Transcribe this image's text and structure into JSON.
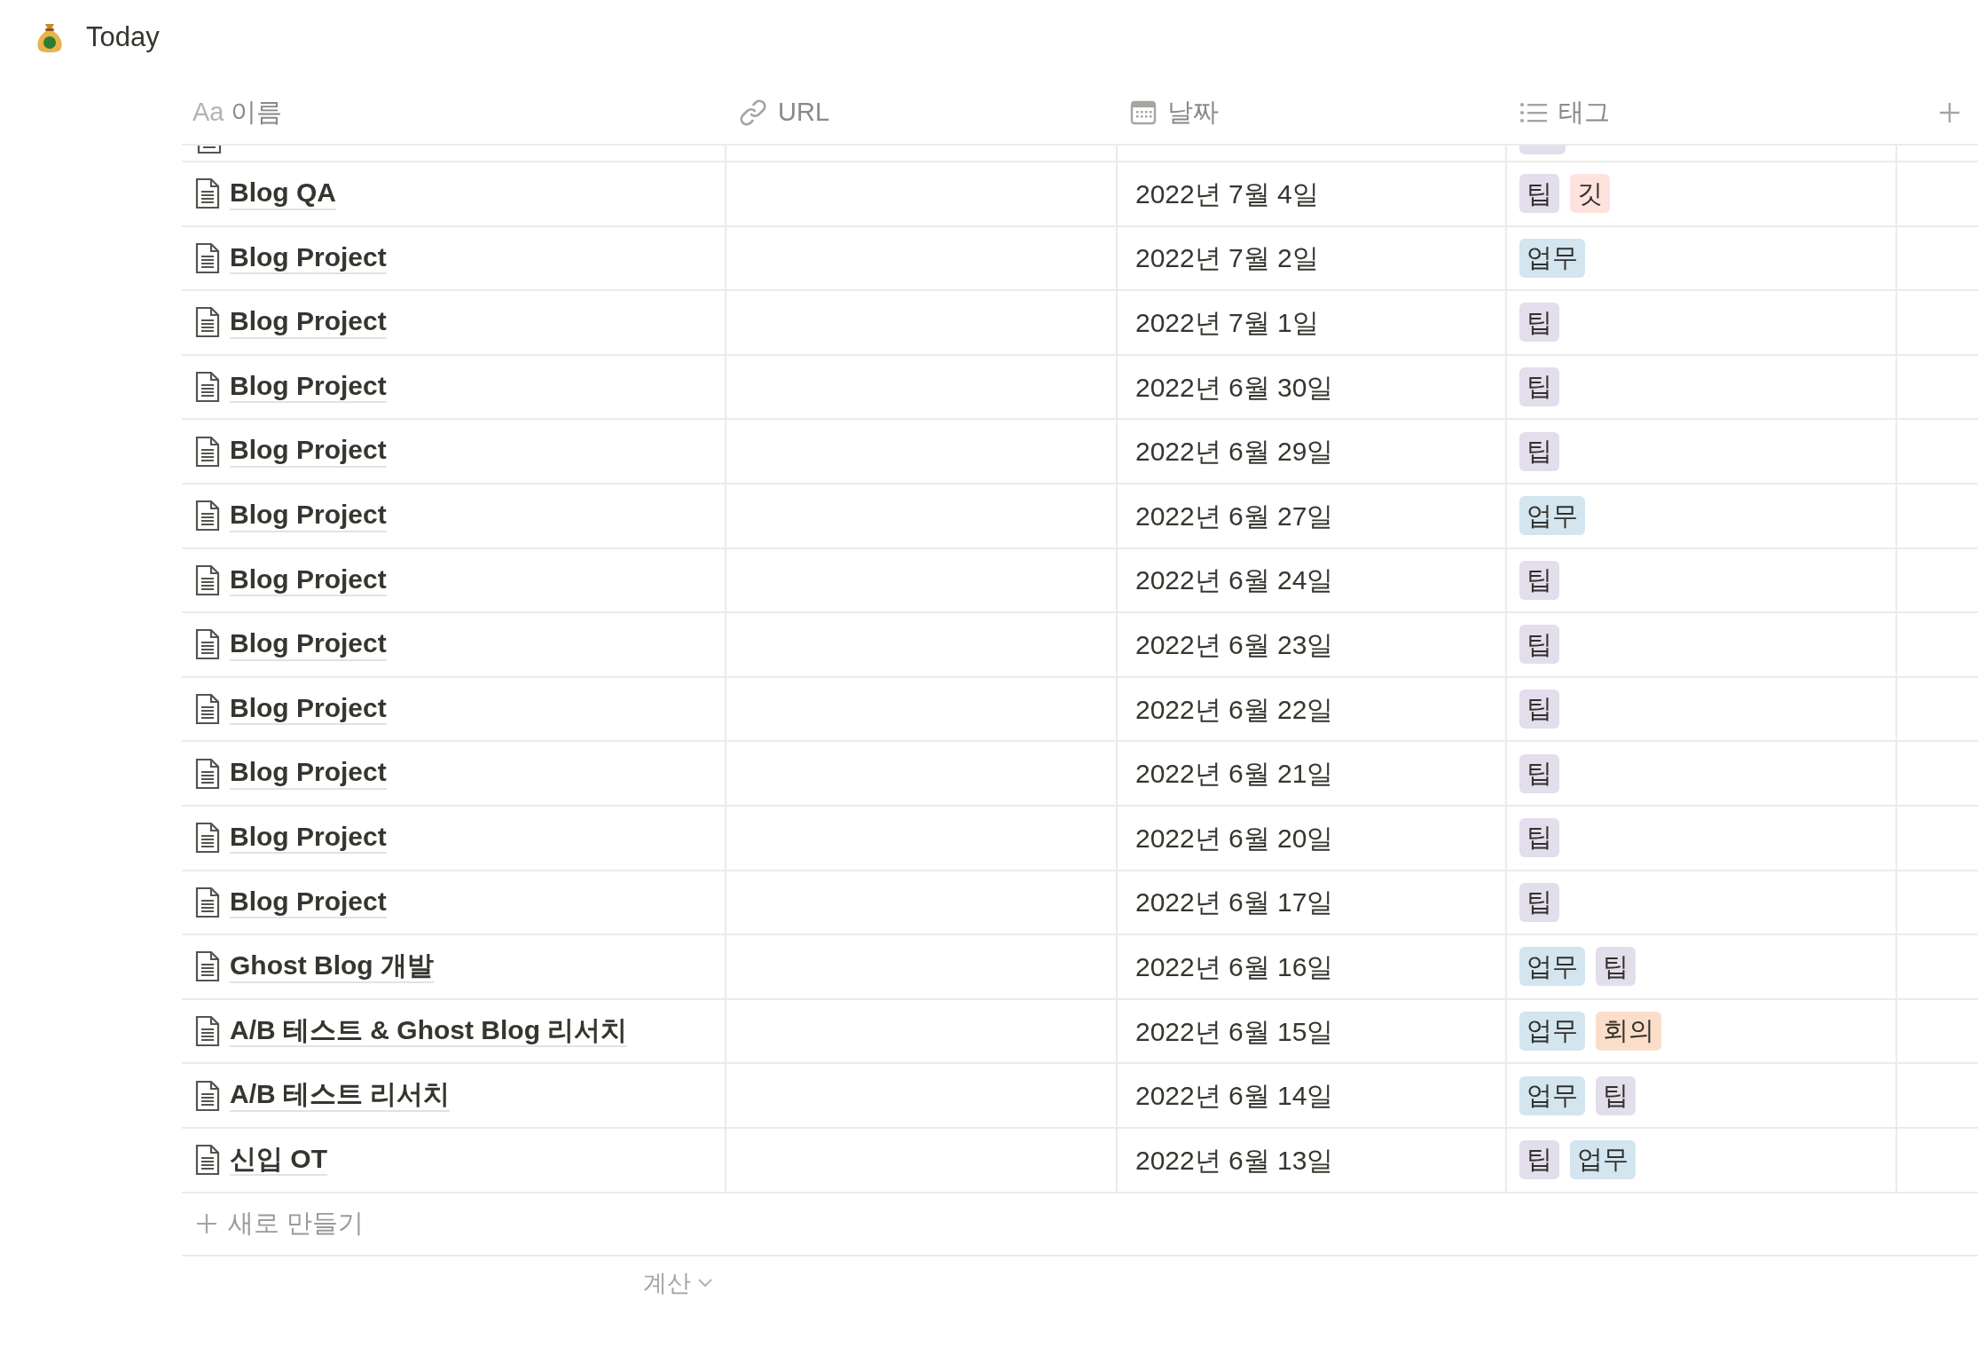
{
  "page": {
    "title": "Today"
  },
  "table": {
    "columns": [
      {
        "kind": "title",
        "icon_text": "Aa",
        "label": "이름"
      },
      {
        "kind": "url",
        "label": "URL"
      },
      {
        "kind": "date",
        "label": "날짜"
      },
      {
        "kind": "multi_select",
        "label": "태그"
      }
    ],
    "rows": [
      {
        "name": "Blog QA",
        "date": "2022년 7월 4일",
        "tags": [
          {
            "label": "팁",
            "color": "#e3deeb"
          },
          {
            "label": "깃",
            "color": "#ffe2dd"
          }
        ]
      },
      {
        "name": "Blog Project",
        "date": "2022년 7월 2일",
        "tags": [
          {
            "label": "업무",
            "color": "#d3e5ef"
          }
        ]
      },
      {
        "name": "Blog Project",
        "date": "2022년 7월 1일",
        "tags": [
          {
            "label": "팁",
            "color": "#e3deeb"
          }
        ]
      },
      {
        "name": "Blog Project",
        "date": "2022년 6월 30일",
        "tags": [
          {
            "label": "팁",
            "color": "#e3deeb"
          }
        ]
      },
      {
        "name": "Blog Project",
        "date": "2022년 6월 29일",
        "tags": [
          {
            "label": "팁",
            "color": "#e3deeb"
          }
        ]
      },
      {
        "name": "Blog Project",
        "date": "2022년 6월 27일",
        "tags": [
          {
            "label": "업무",
            "color": "#d3e5ef"
          }
        ]
      },
      {
        "name": "Blog Project",
        "date": "2022년 6월 24일",
        "tags": [
          {
            "label": "팁",
            "color": "#e3deeb"
          }
        ]
      },
      {
        "name": "Blog Project",
        "date": "2022년 6월 23일",
        "tags": [
          {
            "label": "팁",
            "color": "#e3deeb"
          }
        ]
      },
      {
        "name": "Blog Project",
        "date": "2022년 6월 22일",
        "tags": [
          {
            "label": "팁",
            "color": "#e3deeb"
          }
        ]
      },
      {
        "name": "Blog Project",
        "date": "2022년 6월 21일",
        "tags": [
          {
            "label": "팁",
            "color": "#e3deeb"
          }
        ]
      },
      {
        "name": "Blog Project",
        "date": "2022년 6월 20일",
        "tags": [
          {
            "label": "팁",
            "color": "#e3deeb"
          }
        ]
      },
      {
        "name": "Blog Project",
        "date": "2022년 6월 17일",
        "tags": [
          {
            "label": "팁",
            "color": "#e3deeb"
          }
        ]
      },
      {
        "name": "Ghost Blog 개발",
        "date": "2022년 6월 16일",
        "tags": [
          {
            "label": "업무",
            "color": "#d3e5ef"
          },
          {
            "label": "팁",
            "color": "#e3deeb"
          }
        ]
      },
      {
        "name": "A/B 테스트 & Ghost Blog 리서치",
        "date": "2022년 6월 15일",
        "tags": [
          {
            "label": "업무",
            "color": "#d3e5ef"
          },
          {
            "label": "회의",
            "color": "#fadec9"
          }
        ]
      },
      {
        "name": "A/B 테스트 리서치",
        "date": "2022년 6월 14일",
        "tags": [
          {
            "label": "업무",
            "color": "#d3e5ef"
          },
          {
            "label": "팁",
            "color": "#e3deeb"
          }
        ]
      },
      {
        "name": "신입 OT",
        "date": "2022년 6월 13일",
        "tags": [
          {
            "label": "팁",
            "color": "#e3deeb"
          },
          {
            "label": "업무",
            "color": "#d3e5ef"
          }
        ]
      }
    ],
    "new_row": "새로 만들기",
    "calculate": "계산"
  }
}
